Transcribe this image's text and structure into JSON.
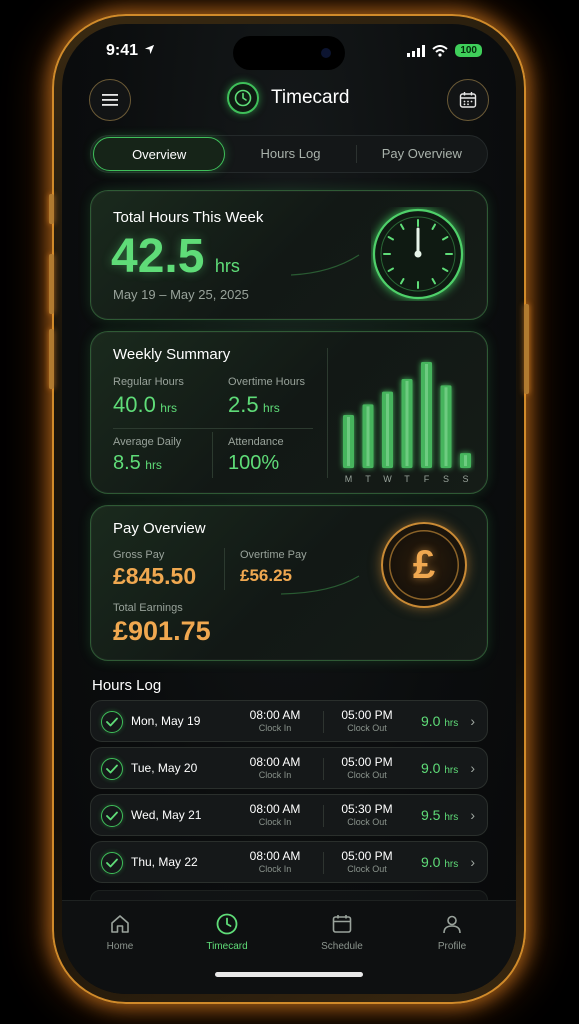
{
  "status_bar": {
    "time": "9:41",
    "battery": "100"
  },
  "header": {
    "title": "Timecard"
  },
  "tabs": [
    {
      "label": "Overview",
      "active": true
    },
    {
      "label": "Hours Log",
      "active": false
    },
    {
      "label": "Pay Overview",
      "active": false
    }
  ],
  "total_hours": {
    "title": "Total Hours This Week",
    "value": "42.5",
    "unit": "hrs",
    "date_range": "May 19 – May 25, 2025"
  },
  "weekly_summary": {
    "title": "Weekly Summary",
    "regular_label": "Regular Hours",
    "regular_value": "40.0",
    "overtime_label": "Overtime Hours",
    "overtime_value": "2.5",
    "average_label": "Average Daily",
    "average_value": "8.5",
    "attendance_label": "Attendance",
    "attendance_value": "100%",
    "unit": "hrs",
    "chart_data": {
      "type": "bar",
      "categories": [
        "M",
        "T",
        "W",
        "T",
        "F",
        "S",
        "S"
      ],
      "values": [
        0.5,
        0.6,
        0.72,
        0.84,
        1.0,
        0.78,
        0.14
      ],
      "color": "#4fd06a"
    }
  },
  "pay_overview": {
    "title": "Pay Overview",
    "gross_label": "Gross Pay",
    "gross_value": "£845.50",
    "overtime_label": "Overtime Pay",
    "overtime_value": "£56.25",
    "total_label": "Total Earnings",
    "total_value": "£901.75",
    "currency_symbol": "£"
  },
  "hours_log": {
    "title": "Hours Log",
    "clock_in_label": "Clock In",
    "clock_out_label": "Clock Out",
    "unit": "hrs",
    "rows": [
      {
        "date": "Mon, May 19",
        "in": "08:00 AM",
        "out": "05:00 PM",
        "hours": "9.0"
      },
      {
        "date": "Tue, May 20",
        "in": "08:00 AM",
        "out": "05:00 PM",
        "hours": "9.0"
      },
      {
        "date": "Wed, May 21",
        "in": "08:00 AM",
        "out": "05:30 PM",
        "hours": "9.5"
      },
      {
        "date": "Thu, May 22",
        "in": "08:00 AM",
        "out": "05:00 PM",
        "hours": "9.0"
      }
    ]
  },
  "nav": [
    {
      "label": "Home",
      "icon": "home-icon",
      "active": false
    },
    {
      "label": "Timecard",
      "icon": "clock-icon",
      "active": true
    },
    {
      "label": "Schedule",
      "icon": "calendar-icon",
      "active": false
    },
    {
      "label": "Profile",
      "icon": "user-icon",
      "active": false
    }
  ],
  "colors": {
    "accent": "#4fd06a",
    "gold": "#f0a850",
    "bezel_glow": "#ff9628"
  }
}
